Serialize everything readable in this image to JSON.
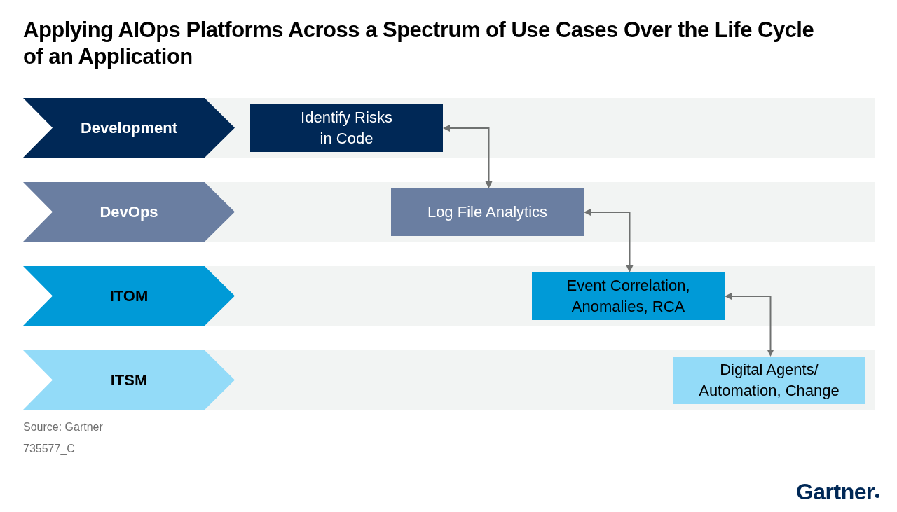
{
  "title": "Applying AIOps Platforms Across a Spectrum of Use Cases Over the Life Cycle of an Application",
  "stages": [
    {
      "label": "Development",
      "color": "#002856",
      "use_case": {
        "lines": [
          "Identify Risks",
          "in Code"
        ]
      }
    },
    {
      "label": "DevOps",
      "color": "#6a7ea1",
      "use_case": {
        "lines": [
          "Log File Analytics"
        ]
      }
    },
    {
      "label": "ITOM",
      "color": "#009ad7",
      "use_case": {
        "lines": [
          "Event Correlation,",
          "Anomalies, RCA"
        ]
      }
    },
    {
      "label": "ITSM",
      "color": "#93dbf8",
      "use_case": {
        "lines": [
          "Digital Agents/",
          "Automation, Change"
        ]
      }
    }
  ],
  "footer": {
    "source": "Source: Gartner",
    "figure_id": "735577_C"
  },
  "logo": {
    "text": "Gartner"
  }
}
